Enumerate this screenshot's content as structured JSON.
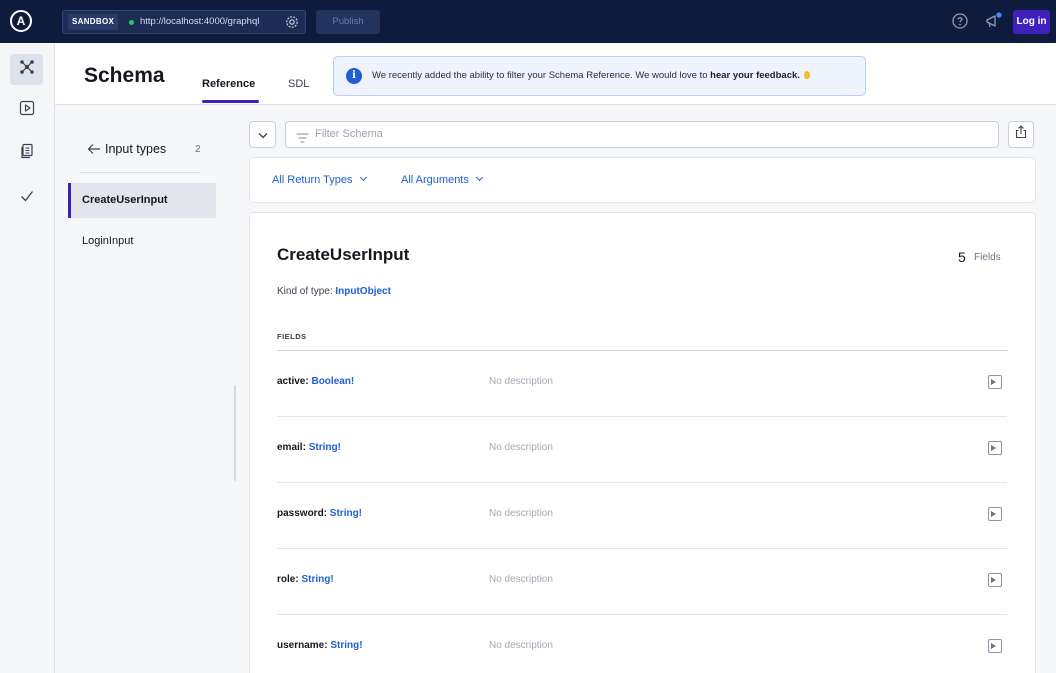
{
  "topbar": {
    "logo_letter": "A",
    "sandbox_label": "SANDBOX",
    "endpoint_url": "http://localhost:4000/graphql",
    "publish_label": "Publish",
    "login_label": "Log in",
    "colors": {
      "background": "#0f1b3d",
      "connected_dot": "#2fc46b",
      "login_button": "#3f20ba"
    }
  },
  "leftnav": {
    "items": [
      {
        "name": "schema",
        "icon": "schema-graph-icon",
        "active": true
      },
      {
        "name": "explorer",
        "icon": "play-square-icon",
        "active": false
      },
      {
        "name": "docs",
        "icon": "documents-icon",
        "active": false
      },
      {
        "name": "checks",
        "icon": "checkmark-icon",
        "active": false
      }
    ]
  },
  "header": {
    "title": "Schema",
    "tabs": [
      {
        "label": "Reference",
        "active": true
      },
      {
        "label": "SDL",
        "active": false
      }
    ],
    "banner": {
      "icon": "info-icon",
      "text": "We recently added the ability to filter your Schema Reference. We would love to",
      "link_text": "hear your feedback."
    }
  },
  "sidebar": {
    "title": "Input types",
    "count": "2",
    "items": [
      {
        "label": "CreateUserInput",
        "active": true
      },
      {
        "label": "LoginInput",
        "active": false
      }
    ]
  },
  "main": {
    "filter_placeholder": "Filter Schema",
    "filters": [
      {
        "label": "All Return Types"
      },
      {
        "label": "All Arguments"
      }
    ],
    "type": {
      "name": "CreateUserInput",
      "field_count": "5",
      "field_count_label": "Fields",
      "kind_label": "Kind of type:",
      "kind_value": "InputObject",
      "fields_heading": "FIELDS",
      "fields": [
        {
          "name": "active:",
          "type": "Boolean!",
          "description": "No description"
        },
        {
          "name": "email:",
          "type": "String!",
          "description": "No description"
        },
        {
          "name": "password:",
          "type": "String!",
          "description": "No description"
        },
        {
          "name": "role:",
          "type": "String!",
          "description": "No description"
        },
        {
          "name": "username:",
          "type": "String!",
          "description": "No description"
        }
      ]
    }
  }
}
